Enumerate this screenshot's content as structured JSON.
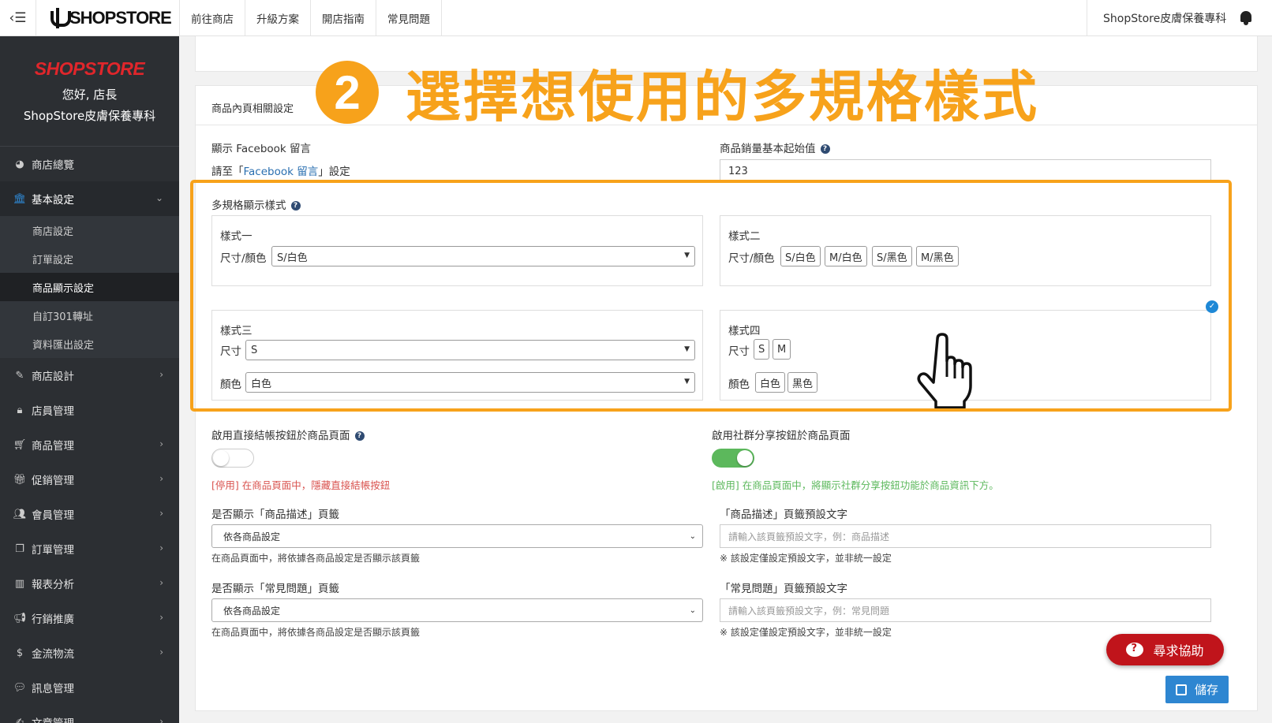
{
  "topbar": {
    "logo": "SHOPSTORE",
    "nav": [
      "前往商店",
      "升級方案",
      "開店指南",
      "常見問題"
    ],
    "store_name": "ShopStore皮膚保養專科"
  },
  "sidebar": {
    "logo": "SHOPSTORE",
    "greeting": "您好, 店長",
    "store_name": "ShopStore皮膚保養專科",
    "items": [
      {
        "label": "商店總覽",
        "icon": "dashboard-icon"
      },
      {
        "label": "基本設定",
        "icon": "bank-icon"
      },
      {
        "label": "商店設計",
        "icon": "magic-wand-icon"
      },
      {
        "label": "店員管理",
        "icon": "lock-icon"
      },
      {
        "label": "商品管理",
        "icon": "cart-icon"
      },
      {
        "label": "促銷管理",
        "icon": "gift-icon"
      },
      {
        "label": "會員管理",
        "icon": "users-icon"
      },
      {
        "label": "訂單管理",
        "icon": "copy-icon"
      },
      {
        "label": "報表分析",
        "icon": "bar-chart-icon"
      },
      {
        "label": "行銷推廣",
        "icon": "megaphone-icon"
      },
      {
        "label": "金流物流",
        "icon": "dollar-icon"
      },
      {
        "label": "訊息管理",
        "icon": "chat-icon"
      },
      {
        "label": "文章管理",
        "icon": "edit-icon"
      }
    ],
    "sub_items": [
      "商店設定",
      "訂單設定",
      "商品顯示設定",
      "自訂301轉址",
      "資料匯出設定"
    ]
  },
  "card": {
    "header": "商品內頁相關設定",
    "fb_label": "顯示 Facebook 留言",
    "fb_text_pre": "請至「",
    "fb_link": "Facebook 留言",
    "fb_text_post": "」設定",
    "sales_label": "商品銷量基本起始值",
    "sales_value": "123"
  },
  "multi_spec": {
    "label": "多規格顯示樣式",
    "style1": {
      "title": "樣式一",
      "row_label": "尺寸/顏色",
      "selected": "S/白色"
    },
    "style2": {
      "title": "樣式二",
      "row_label": "尺寸/顏色",
      "chips": [
        "S/白色",
        "M/白色",
        "S/黑色",
        "M/黑色"
      ]
    },
    "style3": {
      "title": "樣式三",
      "size_label": "尺寸",
      "size_value": "S",
      "color_label": "顏色",
      "color_value": "白色"
    },
    "style4": {
      "title": "樣式四",
      "size_label": "尺寸",
      "sizes": [
        "S",
        "M"
      ],
      "color_label": "顏色",
      "colors": [
        "白色",
        "黑色"
      ]
    }
  },
  "checkout": {
    "label": "啟用直接結帳按鈕於商品頁面",
    "status": "[停用] 在商品頁面中，隱藏直接結帳按鈕"
  },
  "social": {
    "label": "啟用社群分享按鈕於商品頁面",
    "status": "[啟用] 在商品頁面中，將顯示社群分享按鈕功能於商品資訊下方。"
  },
  "desc_tab": {
    "label": "是否顯示「商品描述」頁籤",
    "selected": "依各商品設定",
    "hint": "在商品頁面中，將依據各商品設定是否顯示該頁籤",
    "text_label": "「商品描述」頁籤預設文字",
    "placeholder": "請輸入該頁籤預設文字，例：商品描述",
    "text_hint": "※ 該設定僅設定預設文字，並非統一設定"
  },
  "faq_tab": {
    "label": "是否顯示「常見問題」頁籤",
    "selected": "依各商品設定",
    "hint": "在商品頁面中，將依據各商品設定是否顯示該頁籤",
    "text_label": "「常見問題」頁籤預設文字",
    "placeholder": "請輸入該頁籤預設文字，例：常見問題",
    "text_hint": "※ 該設定僅設定預設文字，並非統一設定"
  },
  "overlay": {
    "step": "2",
    "title": "選擇想使用的多規格樣式"
  },
  "buttons": {
    "help": "尋求協助",
    "save": "儲存"
  },
  "colors": {
    "accent": "#f7a21b",
    "sidebar": "#2c2f33",
    "help": "#c0141b",
    "save": "#2e86d1",
    "on_toggle": "#5cb85c"
  }
}
